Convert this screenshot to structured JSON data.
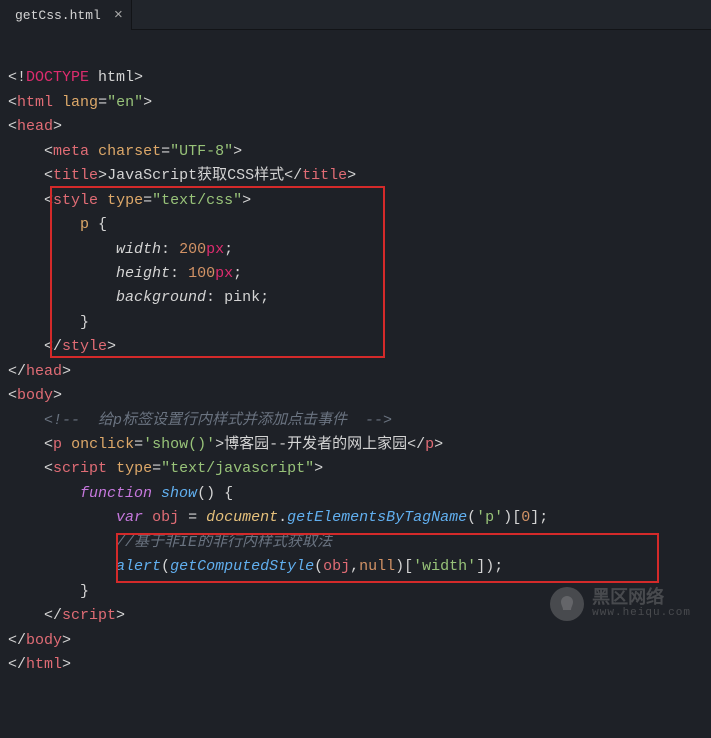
{
  "tab": {
    "filename": "getCss.html",
    "close_glyph": "×"
  },
  "code": {
    "l01": {
      "doctype_pre": "<!",
      "doctype_kw": "DOCTYPE",
      "doctype_sp": " html",
      "close": ">"
    },
    "l02": {
      "open": "<",
      "tag": "html",
      "sp": " ",
      "attr": "lang",
      "eq": "=",
      "val": "\"en\"",
      "close": ">"
    },
    "l03": {
      "open": "<",
      "tag": "head",
      "close": ">"
    },
    "l04": {
      "indent": "    ",
      "open": "<",
      "tag": "meta",
      "sp": " ",
      "attr": "charset",
      "eq": "=",
      "val": "\"UTF-8\"",
      "close": ">"
    },
    "l05": {
      "indent": "    ",
      "open": "<",
      "tag": "title",
      "close": ">",
      "text": "JavaScript获取CSS样式",
      "open2": "</",
      "tag2": "title",
      "close2": ">"
    },
    "l06": {
      "indent": "    ",
      "open": "<",
      "tag": "style",
      "sp": " ",
      "attr": "type",
      "eq": "=",
      "val": "\"text/css\"",
      "close": ">"
    },
    "l07": {
      "indent": "        ",
      "sel": "p",
      "brace": " {"
    },
    "l08": {
      "indent": "            ",
      "prop": "width",
      "colon": ": ",
      "num": "200",
      "unit": "px",
      "semi": ";"
    },
    "l09": {
      "indent": "            ",
      "prop": "height",
      "colon": ": ",
      "num": "100",
      "unit": "px",
      "semi": ";"
    },
    "l10": {
      "indent": "            ",
      "prop": "background",
      "colon": ": ",
      "val": "pink",
      "semi": ";"
    },
    "l11": {
      "indent": "        ",
      "brace": "}"
    },
    "l12": {
      "indent": "    ",
      "open": "</",
      "tag": "style",
      "close": ">"
    },
    "l13": {
      "open": "</",
      "tag": "head",
      "close": ">"
    },
    "l14": {
      "open": "<",
      "tag": "body",
      "close": ">"
    },
    "l15": {
      "indent": "    ",
      "cmt": "<!--  给p标签设置行内样式并添加点击事件  -->"
    },
    "l16": {
      "indent": "    ",
      "open": "<",
      "tag": "p",
      "sp": " ",
      "attr": "onclick",
      "eq": "=",
      "val": "'show()'",
      "close": ">",
      "text": "博客园--开发者的网上家园",
      "open2": "</",
      "tag2": "p",
      "close2": ">"
    },
    "l17": {
      "indent": "    ",
      "open": "<",
      "tag": "script",
      "sp": " ",
      "attr": "type",
      "eq": "=",
      "val": "\"text/javascript\"",
      "close": ">"
    },
    "l18": {
      "indent": "        ",
      "kw": "function",
      "sp": " ",
      "fn": "show",
      "paren": "() {"
    },
    "l19": {
      "indent": "            ",
      "kw": "var",
      "sp": " ",
      "var": "obj",
      "eq": " = ",
      "obj": "document",
      "dot": ".",
      "method": "getElementsByTagName",
      "par1": "(",
      "arg": "'p'",
      "par2": ")[",
      "idx": "0",
      "par3": "];"
    },
    "l20": {
      "indent": "            ",
      "cmt": "//基于非IE的非行内样式获取法"
    },
    "l21": {
      "indent": "            ",
      "fn": "alert",
      "par1": "(",
      "fn2": "getComputedStyle",
      "par2": "(",
      "var": "obj",
      "comma": ",",
      "nul": "null",
      "par3": ")[",
      "arg": "'width'",
      "par4": "]);"
    },
    "l22": {
      "indent": "        ",
      "brace": "}"
    },
    "l23": {
      "indent": "    ",
      "open": "</",
      "tag": "script",
      "close": ">"
    },
    "l24": {
      "open": "</",
      "tag": "body",
      "close": ">"
    },
    "l25": {
      "open": "</",
      "tag": "html",
      "close": ">"
    }
  },
  "watermark": {
    "cn": "黑区网络",
    "url": "www.heiqu.com"
  }
}
